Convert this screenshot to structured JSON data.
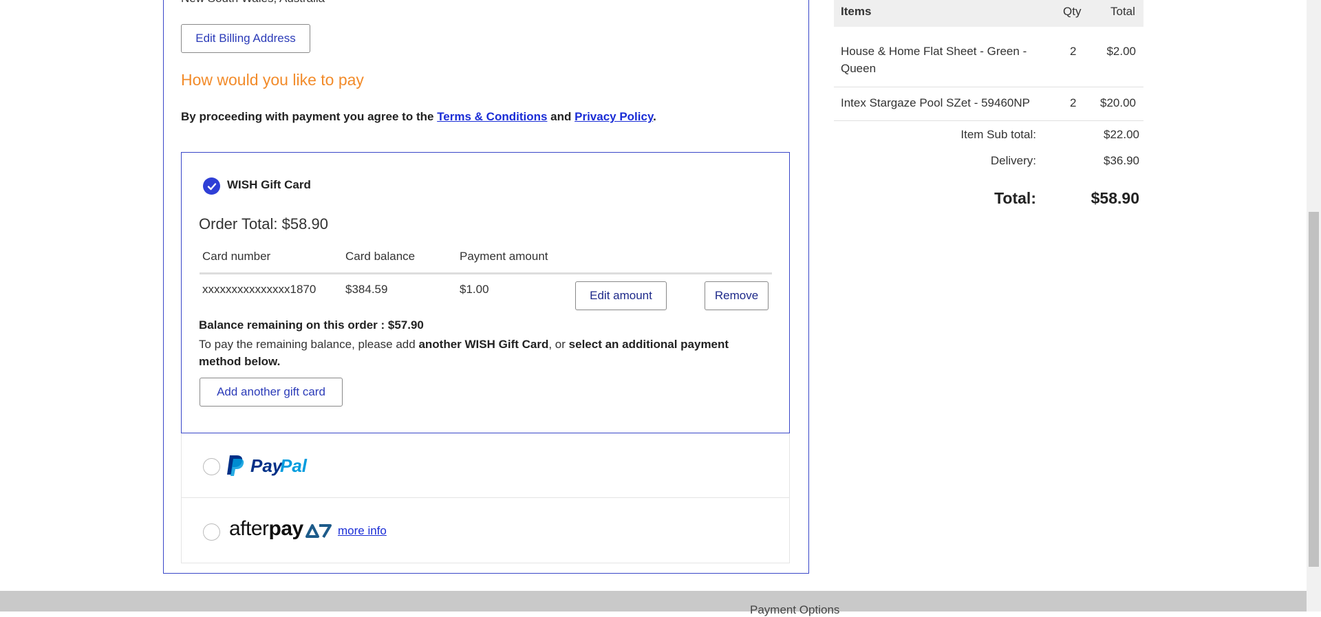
{
  "billing": {
    "address_partial": "New South Wales, Australia",
    "edit_button": "Edit Billing Address"
  },
  "payment": {
    "heading": "How would you like to pay",
    "agree_prefix": "By proceeding with payment you agree to the ",
    "terms_link": "Terms & Conditions",
    "agree_and": " and ",
    "privacy_link": "Privacy Policy",
    "agree_suffix": "."
  },
  "gift_card": {
    "label": "WISH Gift Card",
    "order_total": "Order Total: $58.90",
    "columns": [
      "Card number",
      "Card balance",
      "Payment amount"
    ],
    "row": {
      "card_number": "xxxxxxxxxxxxxxx1870",
      "card_balance": "$384.59",
      "payment_amount": "$1.00"
    },
    "edit_amount": "Edit amount",
    "remove": "Remove",
    "balance_remaining": "Balance remaining on this order : $57.90",
    "pay_remaining_prefix": "To pay the remaining balance, please add ",
    "pay_remaining_bold1": "another WISH Gift Card",
    "pay_remaining_mid": ", or ",
    "pay_remaining_bold2": "select an additional payment method below.",
    "add_another": "Add another gift card"
  },
  "paypal": {
    "logo_text_pay": "Pay",
    "logo_text_pal": "Pal"
  },
  "afterpay": {
    "logo_light": "after",
    "logo_heavy": "pay",
    "more_info": "more info"
  },
  "summary": {
    "headers": {
      "items": "Items",
      "qty": "Qty",
      "total": "Total"
    },
    "items": [
      {
        "name_line1": "House & Home Flat Sheet - Green -",
        "name_line2": "Queen",
        "qty": "2",
        "total": "$2.00"
      },
      {
        "name_line1": "Intex Stargaze Pool SZet - 59460NP",
        "name_line2": "",
        "qty": "2",
        "total": "$20.00"
      }
    ],
    "subtotal_label": "Item Sub total:",
    "subtotal_value": "$22.00",
    "delivery_label": "Delivery:",
    "delivery_value": "$36.90",
    "total_label": "Total:",
    "total_value": "$58.90"
  },
  "footer": {
    "text": "Payment Options"
  },
  "colors": {
    "accent_blue": "#3846c8",
    "link_blue": "#1a2dd6",
    "heading_orange": "#f28b2a",
    "paypal_dark": "#003087",
    "paypal_light": "#009cde",
    "afterpay_teal": "#1d5b8a"
  }
}
